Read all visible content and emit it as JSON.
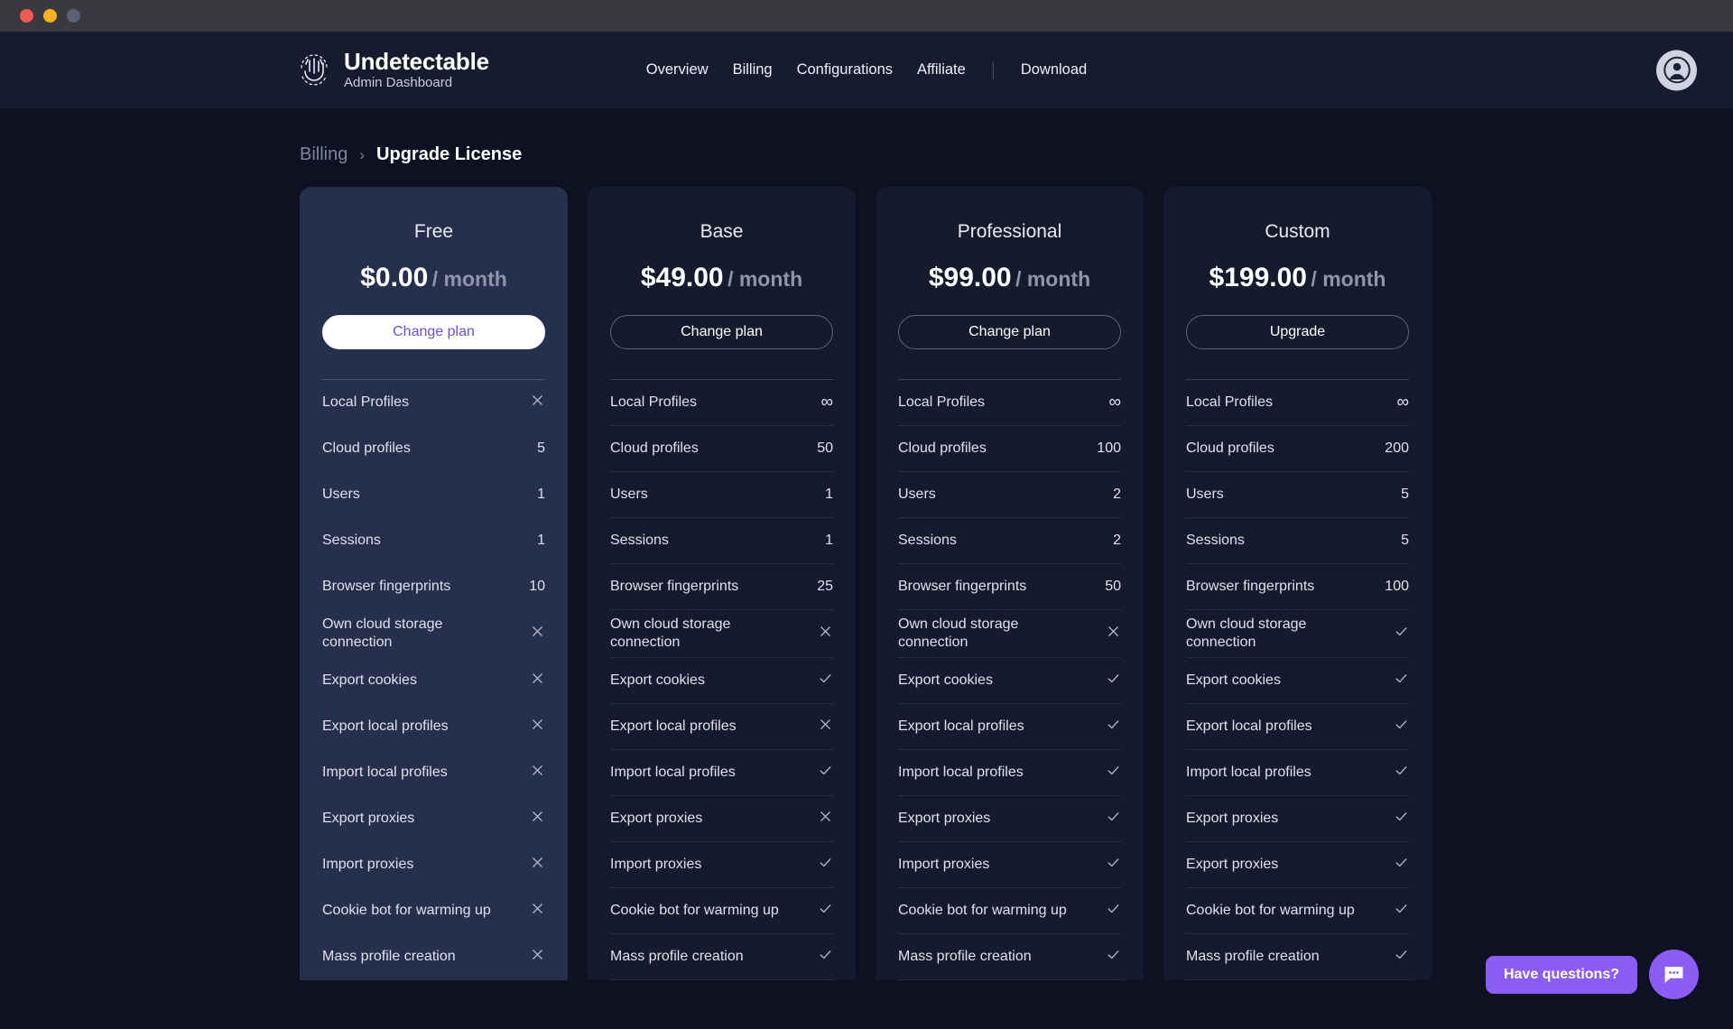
{
  "window": {
    "traffic_lights": [
      "close",
      "minimize",
      "maximize"
    ]
  },
  "header": {
    "brand_name": "Undetectable",
    "brand_subtitle": "Admin Dashboard",
    "logo_icon": "undetectable-hand-logo",
    "nav": [
      {
        "label": "Overview"
      },
      {
        "label": "Billing"
      },
      {
        "label": "Configurations"
      },
      {
        "label": "Affiliate"
      },
      {
        "label": "Download"
      }
    ],
    "avatar_icon": "user-avatar-icon"
  },
  "breadcrumb": {
    "parent": "Billing",
    "separator": "›",
    "current": "Upgrade License"
  },
  "colors": {
    "page_background": "#0d1122",
    "topbar_background": "#161b2e",
    "card_background": "#151a2c",
    "card_highlight_background": "#262f4c",
    "accent_purple": "#8b5cf6",
    "button_text_purple": "#6b4fd8",
    "muted_text": "#8e95ac"
  },
  "feature_labels": [
    "Local Profiles",
    "Cloud profiles",
    "Users",
    "Sessions",
    "Browser fingerprints",
    "Own cloud storage connection",
    "Export cookies",
    "Export local profiles",
    "Import local profiles",
    "Export proxies",
    "Import proxies",
    "Cookie bot for warming up",
    "Mass profile creation"
  ],
  "plans": [
    {
      "name": "Free",
      "price": "$0.00",
      "period": "/ month",
      "button_label": "Change plan",
      "highlight": true,
      "features": [
        {
          "label": "Local Profiles",
          "value": "cross"
        },
        {
          "label": "Cloud profiles",
          "value": "5"
        },
        {
          "label": "Users",
          "value": "1"
        },
        {
          "label": "Sessions",
          "value": "1"
        },
        {
          "label": "Browser fingerprints",
          "value": "10"
        },
        {
          "label": "Own cloud storage connection",
          "value": "cross"
        },
        {
          "label": "Export cookies",
          "value": "cross"
        },
        {
          "label": "Export local profiles",
          "value": "cross"
        },
        {
          "label": "Import local profiles",
          "value": "cross"
        },
        {
          "label": "Export proxies",
          "value": "cross"
        },
        {
          "label": "Import proxies",
          "value": "cross"
        },
        {
          "label": "Cookie bot for warming up",
          "value": "cross"
        },
        {
          "label": "Mass profile creation",
          "value": "cross"
        }
      ]
    },
    {
      "name": "Base",
      "price": "$49.00",
      "period": "/ month",
      "button_label": "Change plan",
      "highlight": false,
      "features": [
        {
          "label": "Local Profiles",
          "value": "∞"
        },
        {
          "label": "Cloud profiles",
          "value": "50"
        },
        {
          "label": "Users",
          "value": "1"
        },
        {
          "label": "Sessions",
          "value": "1"
        },
        {
          "label": "Browser fingerprints",
          "value": "25"
        },
        {
          "label": "Own cloud storage connection",
          "value": "cross"
        },
        {
          "label": "Export cookies",
          "value": "check"
        },
        {
          "label": "Export local profiles",
          "value": "cross"
        },
        {
          "label": "Import local profiles",
          "value": "check"
        },
        {
          "label": "Export proxies",
          "value": "cross"
        },
        {
          "label": "Import proxies",
          "value": "check"
        },
        {
          "label": "Cookie bot for warming up",
          "value": "check"
        },
        {
          "label": "Mass profile creation",
          "value": "check"
        }
      ]
    },
    {
      "name": "Professional",
      "price": "$99.00",
      "period": "/ month",
      "button_label": "Change plan",
      "highlight": false,
      "features": [
        {
          "label": "Local Profiles",
          "value": "∞"
        },
        {
          "label": "Cloud profiles",
          "value": "100"
        },
        {
          "label": "Users",
          "value": "2"
        },
        {
          "label": "Sessions",
          "value": "2"
        },
        {
          "label": "Browser fingerprints",
          "value": "50"
        },
        {
          "label": "Own cloud storage connection",
          "value": "cross"
        },
        {
          "label": "Export cookies",
          "value": "check"
        },
        {
          "label": "Export local profiles",
          "value": "check"
        },
        {
          "label": "Import local profiles",
          "value": "check"
        },
        {
          "label": "Export proxies",
          "value": "check"
        },
        {
          "label": "Import proxies",
          "value": "check"
        },
        {
          "label": "Cookie bot for warming up",
          "value": "check"
        },
        {
          "label": "Mass profile creation",
          "value": "check"
        }
      ]
    },
    {
      "name": "Custom",
      "price": "$199.00",
      "period": "/ month",
      "button_label": "Upgrade",
      "highlight": false,
      "features": [
        {
          "label": "Local Profiles",
          "value": "∞"
        },
        {
          "label": "Cloud profiles",
          "value": "200"
        },
        {
          "label": "Users",
          "value": "5"
        },
        {
          "label": "Sessions",
          "value": "5"
        },
        {
          "label": "Browser fingerprints",
          "value": "100"
        },
        {
          "label": "Own cloud storage connection",
          "value": "check"
        },
        {
          "label": "Export cookies",
          "value": "check"
        },
        {
          "label": "Export local profiles",
          "value": "check"
        },
        {
          "label": "Import local profiles",
          "value": "check"
        },
        {
          "label": "Export proxies",
          "value": "check"
        },
        {
          "label": "Export proxies",
          "value": "check"
        },
        {
          "label": "Cookie bot for warming up",
          "value": "check"
        },
        {
          "label": "Mass profile creation",
          "value": "check"
        }
      ]
    }
  ],
  "chat_widget": {
    "label": "Have questions?",
    "icon": "chat-bubble-icon"
  }
}
